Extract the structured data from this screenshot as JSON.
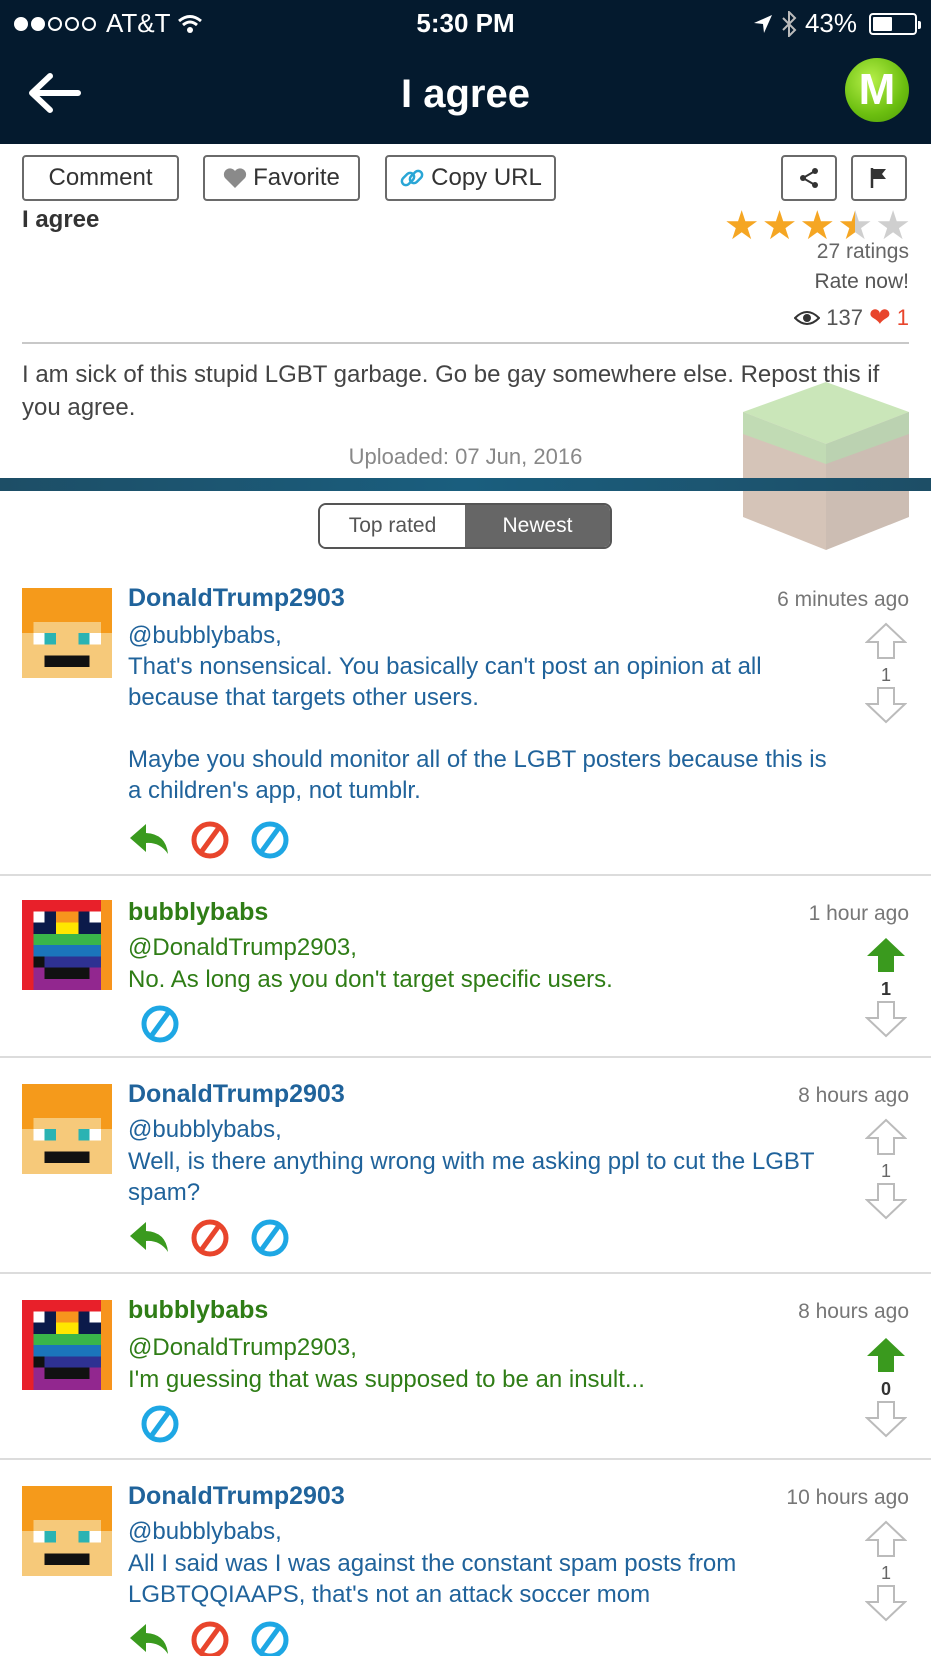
{
  "status_bar": {
    "carrier": "AT&T",
    "time": "5:30 PM",
    "battery": "43%",
    "battery_level": 0.43
  },
  "nav": {
    "title": "I agree",
    "logo_letter": "M"
  },
  "toolbar": {
    "comment_label": "Comment",
    "favorite_label": "Favorite",
    "copy_url_label": "Copy URL"
  },
  "post": {
    "title": "I agree",
    "rating": 3.5,
    "ratings_count": "27 ratings",
    "rate_now": "Rate now!",
    "views": "137",
    "likes": "1",
    "body": "I am sick of this stupid LGBT garbage. Go be gay somewhere else. Repost this if you agree.",
    "uploaded": "Uploaded: 07 Jun, 2016"
  },
  "sort": {
    "top_rated": "Top rated",
    "newest": "Newest",
    "selected": "Newest"
  },
  "comments": [
    {
      "user": "DonaldTrump2903",
      "time": "6 minutes ago",
      "mention": "@bubblybabs,",
      "text": "That's nonsensical. You basically can't post an opinion at all because that targets other users.\n\nMaybe you should monitor all of the LGBT posters because this is a children's app, not tumblr.",
      "votes": "1"
    },
    {
      "user": "bubblybabs",
      "time": "1 hour ago",
      "mention": "@DonaldTrump2903,",
      "text": "No. As long as you don't target specific users.",
      "votes": "1"
    },
    {
      "user": "DonaldTrump2903",
      "time": "8 hours ago",
      "mention": "@bubblybabs,",
      "text": "Well, is there anything wrong with me asking ppl to cut the LGBT spam?",
      "votes": "1"
    },
    {
      "user": "bubblybabs",
      "time": "8 hours ago",
      "mention": "@DonaldTrump2903,",
      "text": "I'm guessing that was supposed to be an insult...",
      "votes": "0"
    },
    {
      "user": "DonaldTrump2903",
      "time": "10 hours ago",
      "mention": "@bubblybabs,",
      "text": "All I said was I was against the constant spam posts from LGBTQQIAAPS, that's not an attack soccer mom",
      "votes": "1"
    }
  ],
  "colors": {
    "nav_bg": "#041a2e",
    "user_blue": "#20639b",
    "user_green": "#2f7d16",
    "star": "#f5a623",
    "upvote_green": "#3a9a1e"
  }
}
